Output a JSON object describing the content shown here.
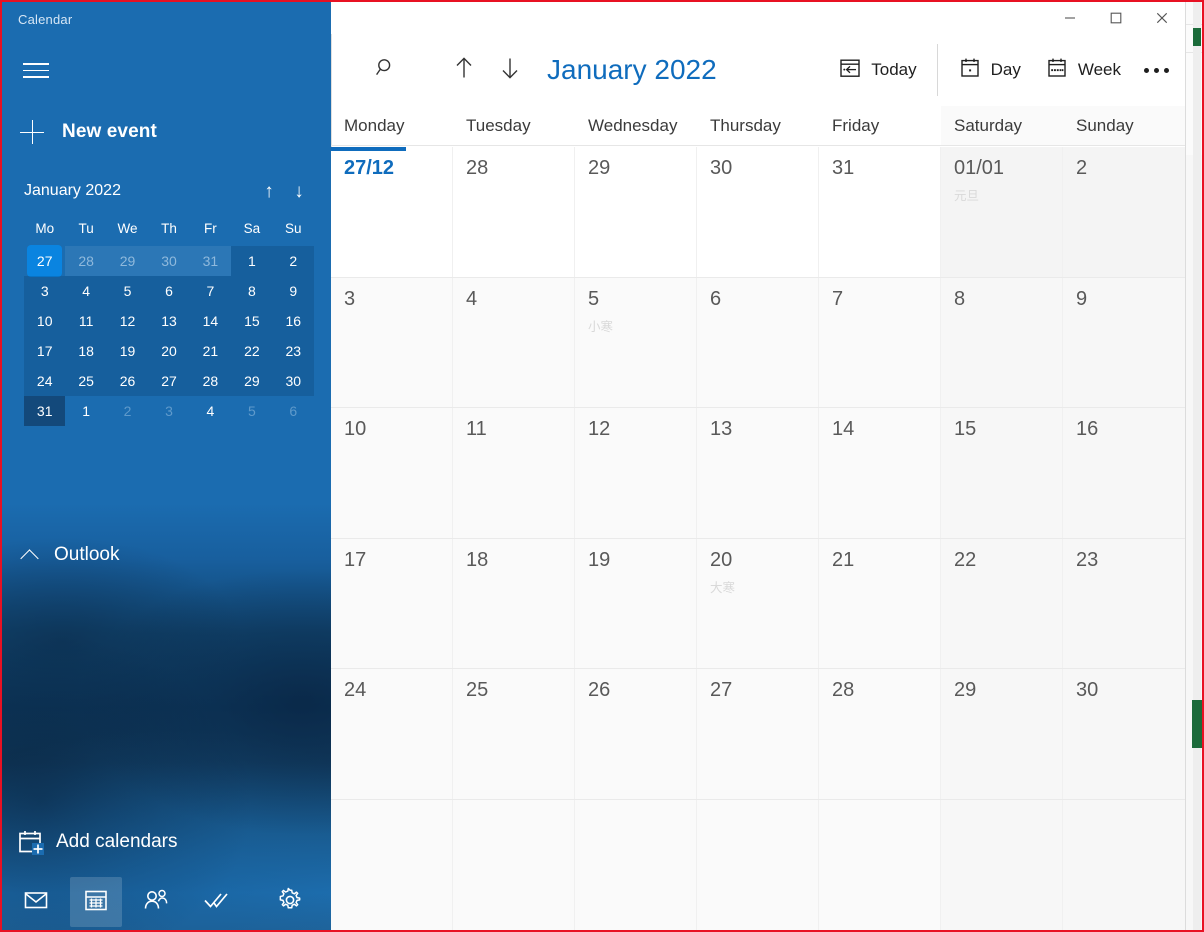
{
  "app": {
    "title": "Calendar",
    "accent": "#0f6cbd",
    "sidebar_bg": "#1b6cb0"
  },
  "window_controls": {
    "minimize": "minimize-icon",
    "maximize": "maximize-icon",
    "close": "close-icon"
  },
  "sidebar": {
    "menu_icon": "hamburger-icon",
    "new_event": {
      "label": "New event",
      "icon": "plus-icon"
    },
    "mini_calendar": {
      "title": "January 2022",
      "prev_icon": "arrow-up-icon",
      "next_icon": "arrow-down-icon",
      "weekday_labels": [
        "Mo",
        "Tu",
        "We",
        "Th",
        "Fr",
        "Sa",
        "Su"
      ],
      "weeks": [
        [
          {
            "d": "27",
            "state": "selected"
          },
          {
            "d": "28",
            "state": "other-month"
          },
          {
            "d": "29",
            "state": "other-month"
          },
          {
            "d": "30",
            "state": "other-month"
          },
          {
            "d": "31",
            "state": "other-month"
          },
          {
            "d": "1",
            "state": "current-shaded"
          },
          {
            "d": "2",
            "state": "current-shaded"
          }
        ],
        [
          {
            "d": "3",
            "state": "current-shaded"
          },
          {
            "d": "4",
            "state": "current-shaded"
          },
          {
            "d": "5",
            "state": "current-shaded"
          },
          {
            "d": "6",
            "state": "current-shaded"
          },
          {
            "d": "7",
            "state": "current-shaded"
          },
          {
            "d": "8",
            "state": "current-shaded"
          },
          {
            "d": "9",
            "state": "current-shaded"
          }
        ],
        [
          {
            "d": "10",
            "state": "current-shaded"
          },
          {
            "d": "11",
            "state": "current-shaded"
          },
          {
            "d": "12",
            "state": "current-shaded"
          },
          {
            "d": "13",
            "state": "current-shaded"
          },
          {
            "d": "14",
            "state": "current-shaded"
          },
          {
            "d": "15",
            "state": "current-shaded"
          },
          {
            "d": "16",
            "state": "current-shaded"
          }
        ],
        [
          {
            "d": "17",
            "state": "current-shaded"
          },
          {
            "d": "18",
            "state": "current-shaded"
          },
          {
            "d": "19",
            "state": "current-shaded"
          },
          {
            "d": "20",
            "state": "current-shaded"
          },
          {
            "d": "21",
            "state": "current-shaded"
          },
          {
            "d": "22",
            "state": "current-shaded"
          },
          {
            "d": "23",
            "state": "current-shaded"
          }
        ],
        [
          {
            "d": "24",
            "state": "current-shaded"
          },
          {
            "d": "25",
            "state": "current-shaded"
          },
          {
            "d": "26",
            "state": "current-shaded"
          },
          {
            "d": "27",
            "state": "current-shaded"
          },
          {
            "d": "28",
            "state": "current-shaded"
          },
          {
            "d": "29",
            "state": "current-shaded"
          },
          {
            "d": "30",
            "state": "current-shaded"
          }
        ],
        [
          {
            "d": "31",
            "state": "current-box"
          },
          {
            "d": "1",
            "state": "next-month"
          },
          {
            "d": "2",
            "state": "next-month-dim"
          },
          {
            "d": "3",
            "state": "next-month-dim"
          },
          {
            "d": "4",
            "state": "next-month"
          },
          {
            "d": "5",
            "state": "next-month-dim"
          },
          {
            "d": "6",
            "state": "next-month-dim"
          }
        ]
      ]
    },
    "account_group": {
      "label": "Outlook",
      "icon": "chevron-up-icon"
    },
    "add_calendars": {
      "label": "Add calendars",
      "icon": "calendar-add-icon"
    },
    "nav_items": [
      {
        "name": "mail",
        "icon": "mail-icon",
        "active": false
      },
      {
        "name": "calendar",
        "icon": "calendar-icon",
        "active": true
      },
      {
        "name": "people",
        "icon": "people-icon",
        "active": false
      },
      {
        "name": "todo",
        "icon": "checkmark-icon",
        "active": false
      },
      {
        "name": "settings",
        "icon": "gear-icon",
        "active": false
      }
    ]
  },
  "toolbar": {
    "search_icon": "search-icon",
    "prev_icon": "arrow-up-icon",
    "next_icon": "arrow-down-icon",
    "month_title": "January 2022",
    "today": {
      "label": "Today",
      "icon": "calendar-today-icon"
    },
    "day": {
      "label": "Day",
      "icon": "calendar-day-icon"
    },
    "week": {
      "label": "Week",
      "icon": "calendar-week-icon"
    },
    "more_icon": "ellipsis-icon"
  },
  "calendar": {
    "day_headers": [
      "Monday",
      "Tuesday",
      "Wednesday",
      "Thursday",
      "Friday",
      "Saturday",
      "Sunday"
    ],
    "weeks": [
      [
        {
          "num": "27/12",
          "sub": "",
          "today": true,
          "weekend": false
        },
        {
          "num": "28",
          "sub": "",
          "today": false,
          "weekend": false
        },
        {
          "num": "29",
          "sub": "",
          "today": false,
          "weekend": false
        },
        {
          "num": "30",
          "sub": "",
          "today": false,
          "weekend": false
        },
        {
          "num": "31",
          "sub": "",
          "today": false,
          "weekend": false
        },
        {
          "num": "01/01",
          "sub": "元旦",
          "today": false,
          "weekend": true
        },
        {
          "num": "2",
          "sub": "",
          "today": false,
          "weekend": true
        }
      ],
      [
        {
          "num": "3",
          "sub": "",
          "today": false,
          "weekend": false
        },
        {
          "num": "4",
          "sub": "",
          "today": false,
          "weekend": false
        },
        {
          "num": "5",
          "sub": "小寒",
          "today": false,
          "weekend": false
        },
        {
          "num": "6",
          "sub": "",
          "today": false,
          "weekend": false
        },
        {
          "num": "7",
          "sub": "",
          "today": false,
          "weekend": false
        },
        {
          "num": "8",
          "sub": "",
          "today": false,
          "weekend": true
        },
        {
          "num": "9",
          "sub": "",
          "today": false,
          "weekend": true
        }
      ],
      [
        {
          "num": "10",
          "sub": "",
          "today": false,
          "weekend": false
        },
        {
          "num": "11",
          "sub": "",
          "today": false,
          "weekend": false
        },
        {
          "num": "12",
          "sub": "",
          "today": false,
          "weekend": false
        },
        {
          "num": "13",
          "sub": "",
          "today": false,
          "weekend": false
        },
        {
          "num": "14",
          "sub": "",
          "today": false,
          "weekend": false
        },
        {
          "num": "15",
          "sub": "",
          "today": false,
          "weekend": true
        },
        {
          "num": "16",
          "sub": "",
          "today": false,
          "weekend": true
        }
      ],
      [
        {
          "num": "17",
          "sub": "",
          "today": false,
          "weekend": false
        },
        {
          "num": "18",
          "sub": "",
          "today": false,
          "weekend": false
        },
        {
          "num": "19",
          "sub": "",
          "today": false,
          "weekend": false
        },
        {
          "num": "20",
          "sub": "大寒",
          "today": false,
          "weekend": false
        },
        {
          "num": "21",
          "sub": "",
          "today": false,
          "weekend": false
        },
        {
          "num": "22",
          "sub": "",
          "today": false,
          "weekend": true
        },
        {
          "num": "23",
          "sub": "",
          "today": false,
          "weekend": true
        }
      ],
      [
        {
          "num": "24",
          "sub": "",
          "today": false,
          "weekend": false
        },
        {
          "num": "25",
          "sub": "",
          "today": false,
          "weekend": false
        },
        {
          "num": "26",
          "sub": "",
          "today": false,
          "weekend": false
        },
        {
          "num": "27",
          "sub": "",
          "today": false,
          "weekend": false
        },
        {
          "num": "28",
          "sub": "",
          "today": false,
          "weekend": false
        },
        {
          "num": "29",
          "sub": "",
          "today": false,
          "weekend": true
        },
        {
          "num": "30",
          "sub": "",
          "today": false,
          "weekend": true
        }
      ],
      [
        {
          "num": "",
          "sub": "",
          "today": false,
          "weekend": false
        },
        {
          "num": "",
          "sub": "",
          "today": false,
          "weekend": false
        },
        {
          "num": "",
          "sub": "",
          "today": false,
          "weekend": false
        },
        {
          "num": "",
          "sub": "",
          "today": false,
          "weekend": false
        },
        {
          "num": "",
          "sub": "",
          "today": false,
          "weekend": false
        },
        {
          "num": "",
          "sub": "",
          "today": false,
          "weekend": true
        },
        {
          "num": "",
          "sub": "",
          "today": false,
          "weekend": true
        }
      ]
    ]
  }
}
